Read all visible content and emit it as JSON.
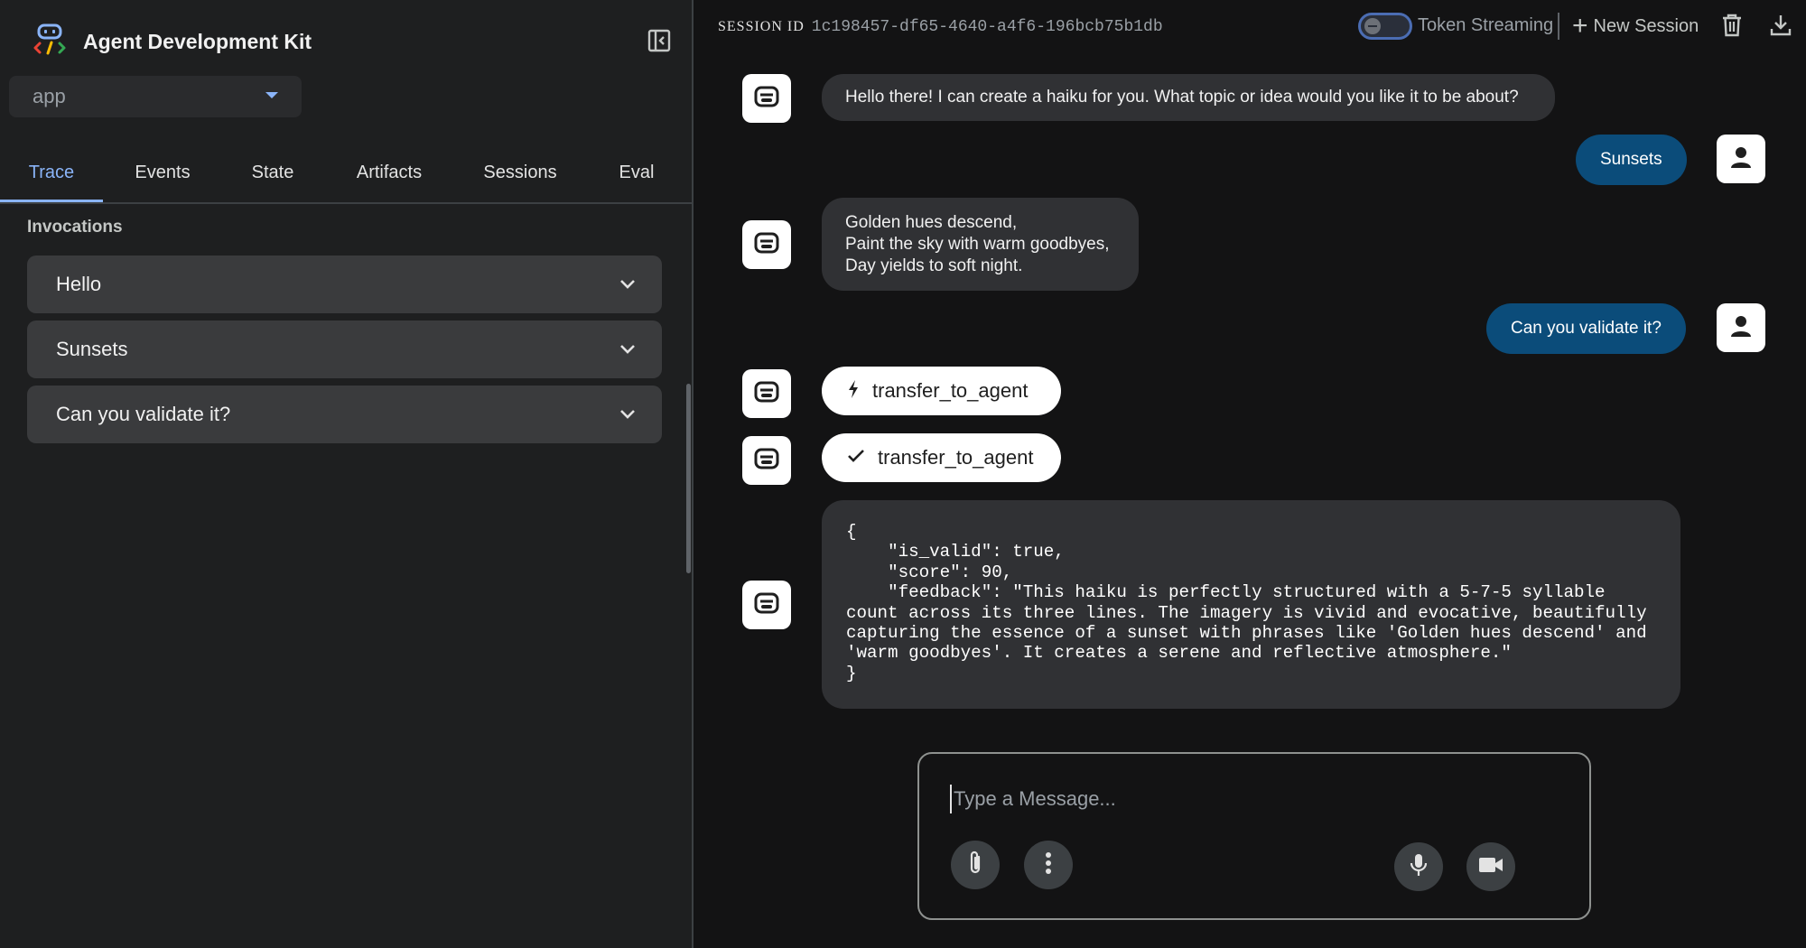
{
  "app": {
    "title": "Agent Development Kit",
    "selected_app": "app"
  },
  "sidebar": {
    "tabs": [
      {
        "label": "Trace",
        "active": true
      },
      {
        "label": "Events"
      },
      {
        "label": "State"
      },
      {
        "label": "Artifacts"
      },
      {
        "label": "Sessions"
      },
      {
        "label": "Eval"
      }
    ],
    "section_label": "Invocations",
    "invocations": [
      {
        "label": "Hello"
      },
      {
        "label": "Sunsets"
      },
      {
        "label": "Can you validate it?"
      }
    ]
  },
  "header": {
    "session_label": "SESSION ID",
    "session_id": "1c198457-df65-4640-a4f6-196bcb75b1db",
    "streaming_label": "Token Streaming",
    "streaming_on": false,
    "new_session_label": "New Session"
  },
  "chat": {
    "bot_greeting": "Hello there! I can create a haiku for you. What topic or idea would you like it to be about?",
    "user_msg_1": "Sunsets",
    "haiku": [
      "Golden hues descend,",
      "Paint the sky with warm goodbyes,",
      "Day yields to soft night."
    ],
    "user_msg_2": "Can you validate it?",
    "tool_call": "transfer_to_agent",
    "tool_response": "transfer_to_agent",
    "json_result": "{\n    \"is_valid\": true,\n    \"score\": 90,\n    \"feedback\": \"This haiku is perfectly structured with a 5-7-5 syllable count across its three lines. The imagery is vivid and evocative, beautifully capturing the essence of a sunset with phrases like 'Golden hues descend' and 'warm goodbyes'. It creates a serene and reflective atmosphere.\"\n}"
  },
  "input": {
    "placeholder": "Type a Message..."
  },
  "colors": {
    "accent": "#8ab4f8",
    "user_bubble": "#0b4c7a",
    "bot_bubble": "#303134",
    "background": "#131314",
    "sidebar": "#1e1f20"
  },
  "icons": {
    "logo": "adk-logo-icon",
    "collapse": "sidebar-collapse-icon",
    "chevron": "chevron-down-icon",
    "trash": "trash-icon",
    "download": "download-icon",
    "bot": "bot-icon",
    "user": "person-icon",
    "bolt": "bolt-icon",
    "check": "check-icon",
    "attach": "paperclip-icon",
    "more": "more-vert-icon",
    "mic": "mic-icon",
    "video": "videocam-icon"
  }
}
